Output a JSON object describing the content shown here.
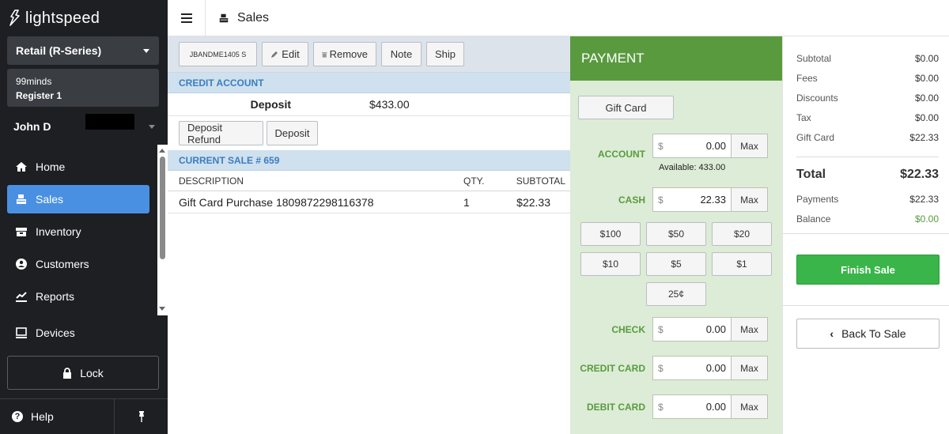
{
  "brand": "lightspeed",
  "sidebar": {
    "shop": "Retail (R-Series)",
    "store": "99minds",
    "register": "Register 1",
    "user": "John D",
    "nav": [
      {
        "label": "Home",
        "icon": "home-icon"
      },
      {
        "label": "Sales",
        "icon": "register-icon",
        "active": true
      },
      {
        "label": "Inventory",
        "icon": "inventory-icon"
      },
      {
        "label": "Customers",
        "icon": "customer-icon"
      },
      {
        "label": "Reports",
        "icon": "reports-icon"
      }
    ],
    "devices": "Devices",
    "lock": "Lock",
    "help": "Help"
  },
  "topbar": {
    "title": "Sales"
  },
  "sale": {
    "toolbar": {
      "customer_code": "JBANDME1405 S",
      "edit": "Edit",
      "remove": "Remove",
      "note": "Note",
      "ship": "Ship"
    },
    "credit_account": {
      "heading": "CREDIT ACCOUNT",
      "deposit_label": "Deposit",
      "deposit_value": "$433.00",
      "deposit_refund_btn": "Deposit Refund",
      "deposit_btn": "Deposit"
    },
    "current_sale": {
      "heading": "CURRENT SALE # 659",
      "columns": {
        "description": "DESCRIPTION",
        "qty": "QTY.",
        "subtotal": "SUBTOTAL"
      },
      "lines": [
        {
          "description": "Gift Card Purchase 1809872298116378",
          "qty": "1",
          "subtotal": "$22.33"
        }
      ]
    }
  },
  "payment": {
    "heading": "PAYMENT",
    "gift_card": "Gift Card",
    "currency": "$",
    "max": "Max",
    "account": {
      "label": "ACCOUNT",
      "value": "0.00",
      "available": "Available: 433.00"
    },
    "cash": {
      "label": "CASH",
      "value": "22.33"
    },
    "cash_buttons": [
      "$100",
      "$50",
      "$20",
      "$10",
      "$5",
      "$1",
      "25¢"
    ],
    "check": {
      "label": "CHECK",
      "value": "0.00"
    },
    "credit_card": {
      "label": "CREDIT CARD",
      "value": "0.00"
    },
    "debit_card": {
      "label": "DEBIT CARD",
      "value": "0.00"
    }
  },
  "totals": {
    "subtotal": {
      "label": "Subtotal",
      "value": "$0.00"
    },
    "fees": {
      "label": "Fees",
      "value": "$0.00"
    },
    "discounts": {
      "label": "Discounts",
      "value": "$0.00"
    },
    "tax": {
      "label": "Tax",
      "value": "$0.00"
    },
    "gift_card": {
      "label": "Gift Card",
      "value": "$22.33"
    },
    "total": {
      "label": "Total",
      "value": "$22.33"
    },
    "payments": {
      "label": "Payments",
      "value": "$22.33"
    },
    "balance": {
      "label": "Balance",
      "value": "$0.00"
    },
    "finish_sale": "Finish Sale",
    "back_to_sale": "Back To Sale"
  },
  "colors": {
    "sidebar_bg": "#1d1f22",
    "active_nav": "#4a90e2",
    "payment_header": "#5a9a3f",
    "payment_bg": "#dcecd6",
    "finish_button": "#3ab54a",
    "section_head": "#cfe0ee"
  }
}
